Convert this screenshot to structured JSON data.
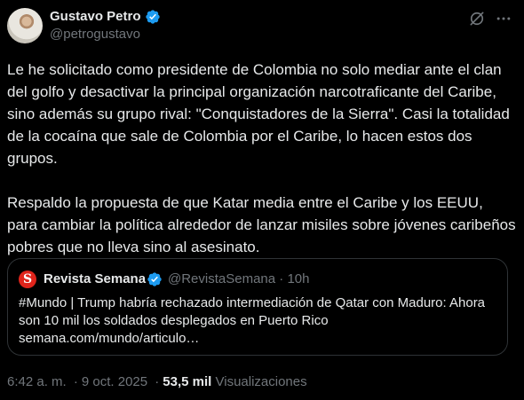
{
  "author": {
    "name": "Gustavo Petro",
    "handle": "@petrogustavo",
    "verified_color": "#1d9bf0"
  },
  "icons": {
    "grok": "grok-icon",
    "more": "more-icon",
    "verified": "verified-badge-icon"
  },
  "tweet": {
    "text": "Le he  solicitado como presidente de Colombia no solo mediar ante el clan del golfo y desactivar la principal organización narcotraficante del Caribe, sino además su grupo rival: \"Conquistadores de la Sierra\". Casi la totalidad de la cocaína que sale de Colombia por el Caribe, lo hacen estos dos grupos.\n\nRespaldo la propuesta de que Katar media entre el Caribe y los EEUU, para cambiar la política alrededor de lanzar misiles sobre jóvenes caribeños pobres que no lleva sino al asesinato."
  },
  "quote": {
    "logo_letter": "S",
    "logo_color": "#e0241b",
    "name": "Revista Semana",
    "handle": "@RevistaSemana",
    "separator": "·",
    "time": "10h",
    "text": "#Mundo | Trump habría rechazado intermediación de Qatar con Maduro: Ahora son 10 mil los soldados desplegados en Puerto Rico\nsemana.com/mundo/articulo…"
  },
  "footer": {
    "time": "6:42 a. m.",
    "separator": "·",
    "date": "9 oct. 2025",
    "views_count": "53,5 mil",
    "views_label": "Visualizaciones"
  }
}
